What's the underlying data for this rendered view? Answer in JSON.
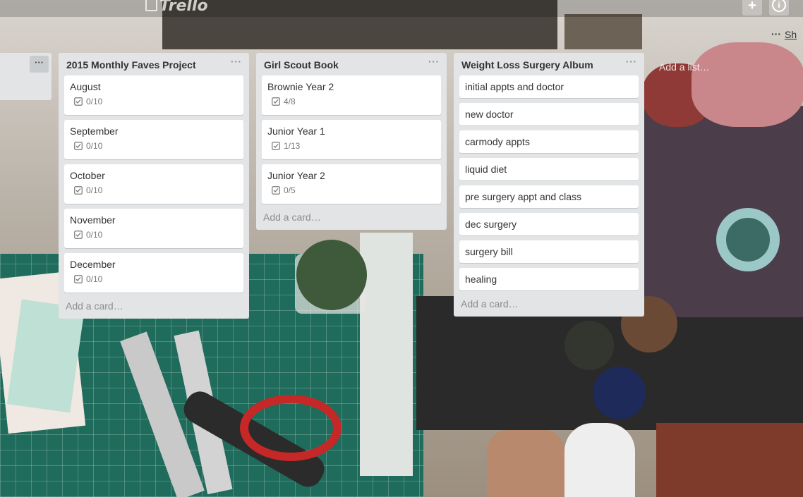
{
  "header": {
    "logo_text": "Trello",
    "add_button": "+",
    "info_button": "i"
  },
  "board": {
    "more_label": "···",
    "show_menu_label": "Sh"
  },
  "partial_list": {
    "menu_label": "···"
  },
  "lists": [
    {
      "title": "2015 Monthly Faves Project",
      "menu_label": "···",
      "cards": [
        {
          "title": "August",
          "checklist": "0/10"
        },
        {
          "title": "September",
          "checklist": "0/10"
        },
        {
          "title": "October",
          "checklist": "0/10"
        },
        {
          "title": "November",
          "checklist": "0/10"
        },
        {
          "title": "December",
          "checklist": "0/10"
        }
      ],
      "add_card": "Add a card…"
    },
    {
      "title": "Girl Scout Book",
      "menu_label": "···",
      "cards": [
        {
          "title": "Brownie Year 2",
          "checklist": "4/8"
        },
        {
          "title": "Junior Year 1",
          "checklist": "1/13"
        },
        {
          "title": "Junior Year 2",
          "checklist": "0/5"
        }
      ],
      "add_card": "Add a card…"
    },
    {
      "title": "Weight Loss Surgery Album",
      "menu_label": "···",
      "cards": [
        {
          "title": "initial appts and doctor"
        },
        {
          "title": "new doctor"
        },
        {
          "title": "carmody appts"
        },
        {
          "title": "liquid diet"
        },
        {
          "title": "pre surgery appt and class"
        },
        {
          "title": "dec surgery"
        },
        {
          "title": "surgery bill"
        },
        {
          "title": "healing"
        }
      ],
      "add_card": "Add a card…"
    }
  ],
  "add_list_label": "Add a list…"
}
